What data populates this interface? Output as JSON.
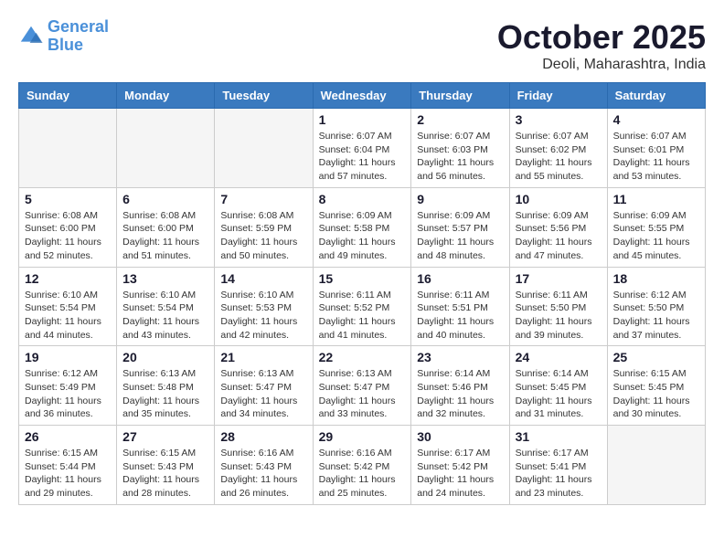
{
  "logo": {
    "general": "General",
    "blue": "Blue"
  },
  "header": {
    "title": "October 2025",
    "location": "Deoli, Maharashtra, India"
  },
  "weekdays": [
    "Sunday",
    "Monday",
    "Tuesday",
    "Wednesday",
    "Thursday",
    "Friday",
    "Saturday"
  ],
  "weeks": [
    [
      {
        "day": "",
        "info": ""
      },
      {
        "day": "",
        "info": ""
      },
      {
        "day": "",
        "info": ""
      },
      {
        "day": "1",
        "info": "Sunrise: 6:07 AM\nSunset: 6:04 PM\nDaylight: 11 hours\nand 57 minutes."
      },
      {
        "day": "2",
        "info": "Sunrise: 6:07 AM\nSunset: 6:03 PM\nDaylight: 11 hours\nand 56 minutes."
      },
      {
        "day": "3",
        "info": "Sunrise: 6:07 AM\nSunset: 6:02 PM\nDaylight: 11 hours\nand 55 minutes."
      },
      {
        "day": "4",
        "info": "Sunrise: 6:07 AM\nSunset: 6:01 PM\nDaylight: 11 hours\nand 53 minutes."
      }
    ],
    [
      {
        "day": "5",
        "info": "Sunrise: 6:08 AM\nSunset: 6:00 PM\nDaylight: 11 hours\nand 52 minutes."
      },
      {
        "day": "6",
        "info": "Sunrise: 6:08 AM\nSunset: 6:00 PM\nDaylight: 11 hours\nand 51 minutes."
      },
      {
        "day": "7",
        "info": "Sunrise: 6:08 AM\nSunset: 5:59 PM\nDaylight: 11 hours\nand 50 minutes."
      },
      {
        "day": "8",
        "info": "Sunrise: 6:09 AM\nSunset: 5:58 PM\nDaylight: 11 hours\nand 49 minutes."
      },
      {
        "day": "9",
        "info": "Sunrise: 6:09 AM\nSunset: 5:57 PM\nDaylight: 11 hours\nand 48 minutes."
      },
      {
        "day": "10",
        "info": "Sunrise: 6:09 AM\nSunset: 5:56 PM\nDaylight: 11 hours\nand 47 minutes."
      },
      {
        "day": "11",
        "info": "Sunrise: 6:09 AM\nSunset: 5:55 PM\nDaylight: 11 hours\nand 45 minutes."
      }
    ],
    [
      {
        "day": "12",
        "info": "Sunrise: 6:10 AM\nSunset: 5:54 PM\nDaylight: 11 hours\nand 44 minutes."
      },
      {
        "day": "13",
        "info": "Sunrise: 6:10 AM\nSunset: 5:54 PM\nDaylight: 11 hours\nand 43 minutes."
      },
      {
        "day": "14",
        "info": "Sunrise: 6:10 AM\nSunset: 5:53 PM\nDaylight: 11 hours\nand 42 minutes."
      },
      {
        "day": "15",
        "info": "Sunrise: 6:11 AM\nSunset: 5:52 PM\nDaylight: 11 hours\nand 41 minutes."
      },
      {
        "day": "16",
        "info": "Sunrise: 6:11 AM\nSunset: 5:51 PM\nDaylight: 11 hours\nand 40 minutes."
      },
      {
        "day": "17",
        "info": "Sunrise: 6:11 AM\nSunset: 5:50 PM\nDaylight: 11 hours\nand 39 minutes."
      },
      {
        "day": "18",
        "info": "Sunrise: 6:12 AM\nSunset: 5:50 PM\nDaylight: 11 hours\nand 37 minutes."
      }
    ],
    [
      {
        "day": "19",
        "info": "Sunrise: 6:12 AM\nSunset: 5:49 PM\nDaylight: 11 hours\nand 36 minutes."
      },
      {
        "day": "20",
        "info": "Sunrise: 6:13 AM\nSunset: 5:48 PM\nDaylight: 11 hours\nand 35 minutes."
      },
      {
        "day": "21",
        "info": "Sunrise: 6:13 AM\nSunset: 5:47 PM\nDaylight: 11 hours\nand 34 minutes."
      },
      {
        "day": "22",
        "info": "Sunrise: 6:13 AM\nSunset: 5:47 PM\nDaylight: 11 hours\nand 33 minutes."
      },
      {
        "day": "23",
        "info": "Sunrise: 6:14 AM\nSunset: 5:46 PM\nDaylight: 11 hours\nand 32 minutes."
      },
      {
        "day": "24",
        "info": "Sunrise: 6:14 AM\nSunset: 5:45 PM\nDaylight: 11 hours\nand 31 minutes."
      },
      {
        "day": "25",
        "info": "Sunrise: 6:15 AM\nSunset: 5:45 PM\nDaylight: 11 hours\nand 30 minutes."
      }
    ],
    [
      {
        "day": "26",
        "info": "Sunrise: 6:15 AM\nSunset: 5:44 PM\nDaylight: 11 hours\nand 29 minutes."
      },
      {
        "day": "27",
        "info": "Sunrise: 6:15 AM\nSunset: 5:43 PM\nDaylight: 11 hours\nand 28 minutes."
      },
      {
        "day": "28",
        "info": "Sunrise: 6:16 AM\nSunset: 5:43 PM\nDaylight: 11 hours\nand 26 minutes."
      },
      {
        "day": "29",
        "info": "Sunrise: 6:16 AM\nSunset: 5:42 PM\nDaylight: 11 hours\nand 25 minutes."
      },
      {
        "day": "30",
        "info": "Sunrise: 6:17 AM\nSunset: 5:42 PM\nDaylight: 11 hours\nand 24 minutes."
      },
      {
        "day": "31",
        "info": "Sunrise: 6:17 AM\nSunset: 5:41 PM\nDaylight: 11 hours\nand 23 minutes."
      },
      {
        "day": "",
        "info": ""
      }
    ]
  ]
}
